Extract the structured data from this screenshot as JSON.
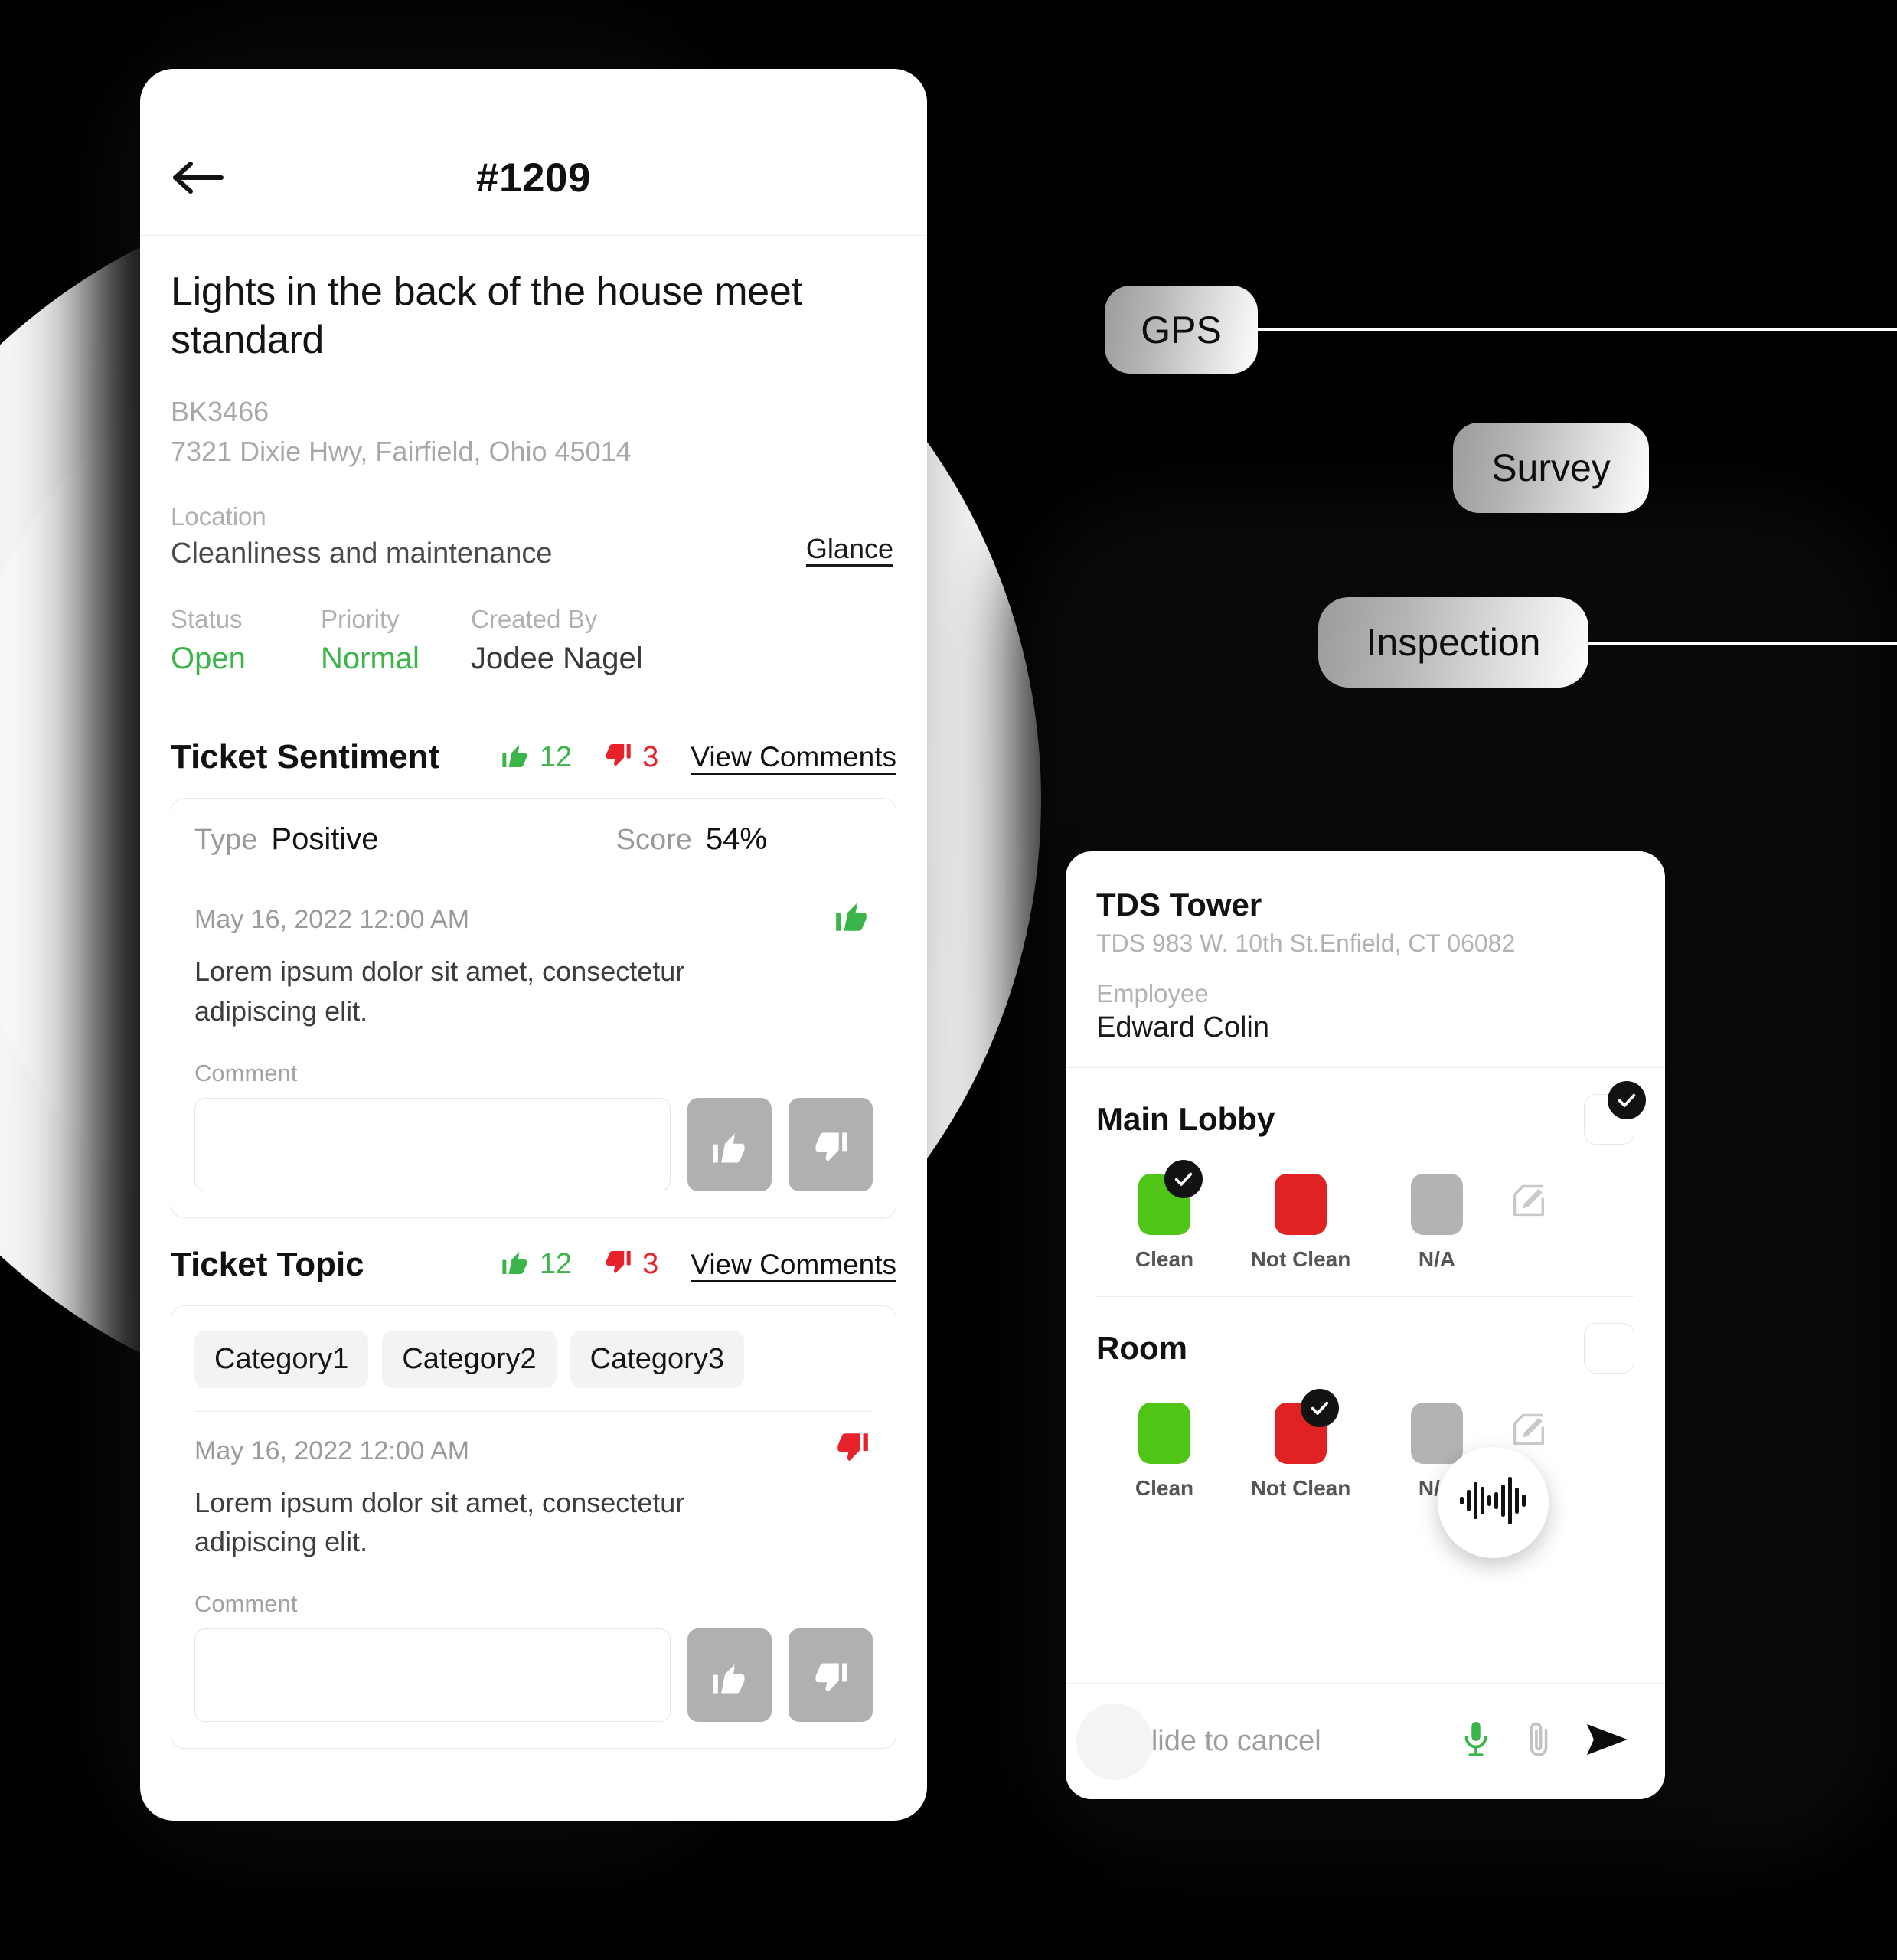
{
  "ticket_phone": {
    "header": {
      "title": "#1209",
      "back_icon": "arrow-left-icon"
    },
    "title": "Lights in the back of the house meet standard",
    "code": "BK3466",
    "address": "7321 Dixie Hwy, Fairfield, Ohio 45014",
    "location": {
      "label": "Location",
      "value": "Cleanliness and maintenance",
      "glance_link": "Glance"
    },
    "meta": [
      {
        "label": "Status",
        "value": "Open",
        "tone": "green"
      },
      {
        "label": "Priority",
        "value": "Normal",
        "tone": "green"
      },
      {
        "label": "Created By",
        "value": "Jodee Nagel",
        "tone": "dark"
      }
    ],
    "sentiment_section": {
      "title": "Ticket Sentiment",
      "thumbs_up": "12",
      "thumbs_down": "3",
      "view_comments": "View Comments",
      "type_label": "Type",
      "type_value": "Positive",
      "score_label": "Score",
      "score_value": "54%",
      "entry_date": "May 16, 2022  12:00 AM",
      "entry_text": "Lorem ipsum dolor sit amet, consectetur adipiscing elit.",
      "entry_badge": "thumbs-up-green",
      "comment_label": "Comment",
      "comment_value": "",
      "comment_placeholder": ""
    },
    "topic_section": {
      "title": "Ticket Topic",
      "thumbs_up": "12",
      "thumbs_down": "3",
      "view_comments": "View Comments",
      "categories": [
        "Category1",
        "Category2",
        "Category3"
      ],
      "entry_date": "May 16, 2022  12:00 AM",
      "entry_text": "Lorem ipsum dolor sit amet, consectetur adipiscing elit.",
      "entry_badge": "thumbs-down-red",
      "comment_label": "Comment",
      "comment_value": "",
      "comment_placeholder": ""
    }
  },
  "pills": [
    {
      "label": "GPS"
    },
    {
      "label": "Survey"
    },
    {
      "label": "Inspection"
    }
  ],
  "inspection_phone": {
    "site_name": "TDS Tower",
    "site_address": "TDS 983 W. 10th St.Enfield, CT 06082",
    "employee_label": "Employee",
    "employee_name": "Edward Colin",
    "groups": [
      {
        "name": "Main Lobby",
        "checked": true,
        "options": [
          {
            "label": "Clean",
            "color": "#4fc518",
            "selected": true
          },
          {
            "label": "Not Clean",
            "color": "#e02222",
            "selected": false
          },
          {
            "label": "N/A",
            "color": "#b3b3b3",
            "selected": false
          }
        ]
      },
      {
        "name": "Room",
        "checked": false,
        "options": [
          {
            "label": "Clean",
            "color": "#4fc518",
            "selected": false
          },
          {
            "label": "Not Clean",
            "color": "#e02222",
            "selected": true
          },
          {
            "label": "N/A",
            "color": "#b3b3b3",
            "selected": false
          }
        ]
      }
    ],
    "footer": {
      "chevrons": "«",
      "slide_to_cancel": "Slide to cancel",
      "mic_icon": "microphone-icon",
      "attach_icon": "paperclip-icon",
      "send_icon": "send-icon"
    },
    "voice_bubble_icon": "audio-waveform-icon"
  },
  "colors": {
    "green": "#3bb54a",
    "red": "#e8222a",
    "swatch_green": "#4fc518",
    "swatch_red": "#e02222",
    "swatch_grey": "#b3b3b3",
    "mic_green": "#3bb54a"
  }
}
